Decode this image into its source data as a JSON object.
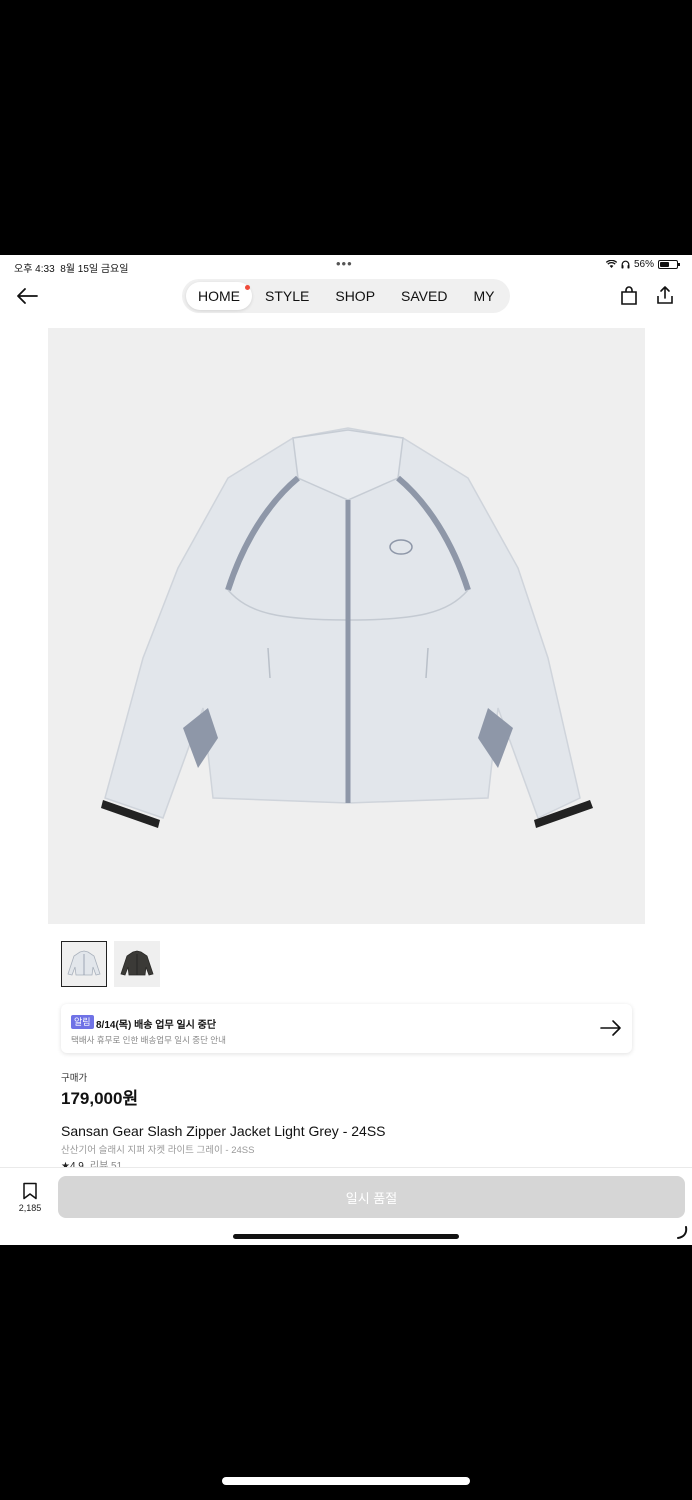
{
  "status_bar": {
    "time": "오후 4:33",
    "date": "8월 15일 금요일",
    "dots": "•••",
    "battery": "56%",
    "battery_level": 0.56
  },
  "nav": {
    "tabs": [
      {
        "label": "HOME",
        "active": true,
        "has_dot": true
      },
      {
        "label": "STYLE",
        "active": false
      },
      {
        "label": "SHOP",
        "active": false
      },
      {
        "label": "SAVED",
        "active": false
      },
      {
        "label": "MY",
        "active": false
      }
    ]
  },
  "notice": {
    "badge": "알림",
    "title": "8/14(목) 배송 업무 일시 중단",
    "subtitle": "택배사 휴무로 인한 배송업무 일시 중단 안내"
  },
  "product": {
    "price_label": "구매가",
    "price": "179,000원",
    "name": "Sansan Gear Slash Zipper Jacket Light Grey - 24SS",
    "name_kr": "산산기어 슬래시 지퍼 자켓 라이트 그레이 - 24SS",
    "rating": "★4.9",
    "reviews": "리뷰 51"
  },
  "bottom_bar": {
    "save_count": "2,185",
    "button_label": "일시 품절"
  },
  "colors": {
    "accent": "#6f72e6",
    "dot": "#f04b3a",
    "disabled_button": "#d6d6d6",
    "jacket": "#e3e6ea",
    "piping": "#8e97a8"
  }
}
